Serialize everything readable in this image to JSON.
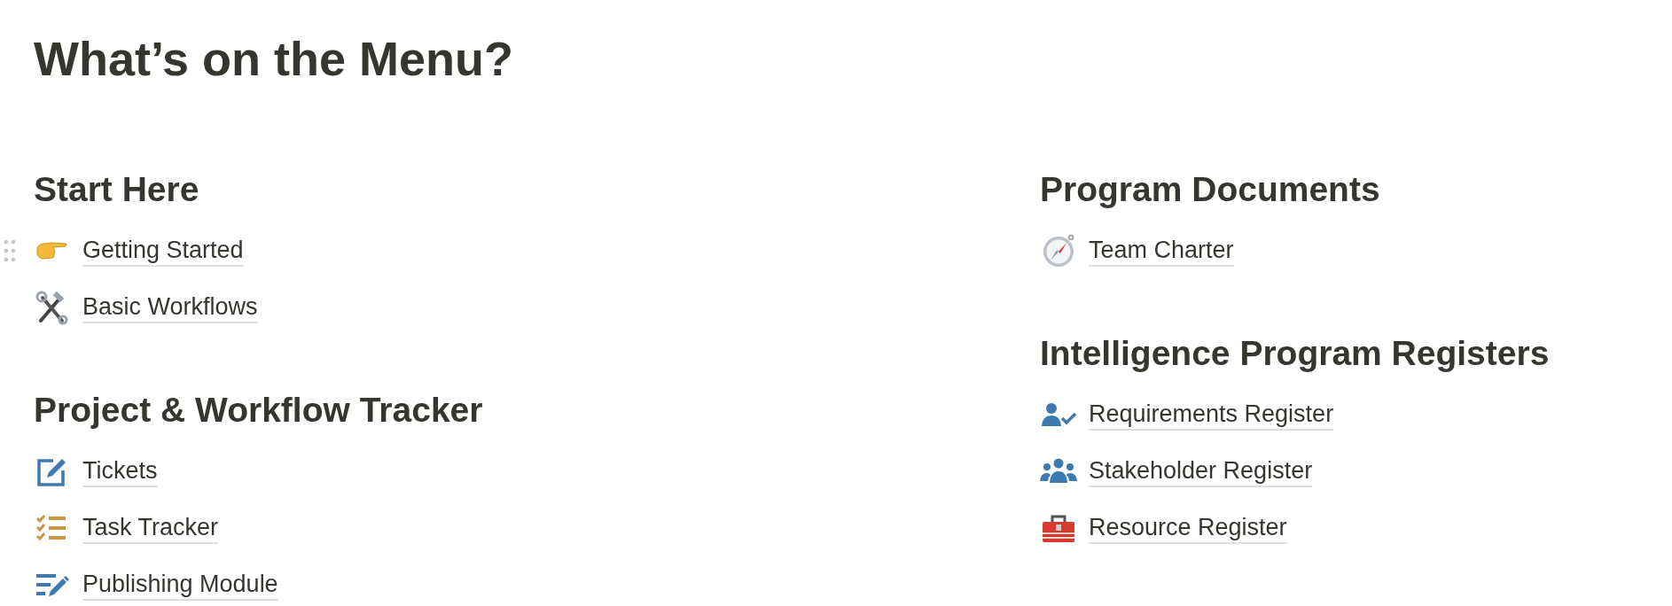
{
  "title": "What’s on the Menu?",
  "columns": [
    {
      "sections": [
        {
          "heading": "Start Here",
          "items": [
            {
              "label": "Getting Started",
              "kind": "pointing-hand",
              "hovered": true
            },
            {
              "label": "Basic Workflows",
              "kind": "tools",
              "hovered": false
            }
          ]
        },
        {
          "heading": "Project & Workflow Tracker",
          "items": [
            {
              "label": "Tickets",
              "kind": "edit",
              "hovered": false
            },
            {
              "label": "Task Tracker",
              "kind": "checklist",
              "hovered": false
            },
            {
              "label": "Publishing Module",
              "kind": "write",
              "hovered": false
            }
          ]
        }
      ]
    },
    {
      "sections": [
        {
          "heading": "Program Documents",
          "items": [
            {
              "label": "Team Charter",
              "kind": "compass",
              "hovered": false
            }
          ]
        },
        {
          "heading": "Intelligence Program Registers",
          "items": [
            {
              "label": "Requirements Register",
              "kind": "person-check",
              "hovered": false
            },
            {
              "label": "Stakeholder Register",
              "kind": "people",
              "hovered": false
            },
            {
              "label": "Resource Register",
              "kind": "toolbox",
              "hovered": false
            }
          ]
        }
      ]
    }
  ]
}
